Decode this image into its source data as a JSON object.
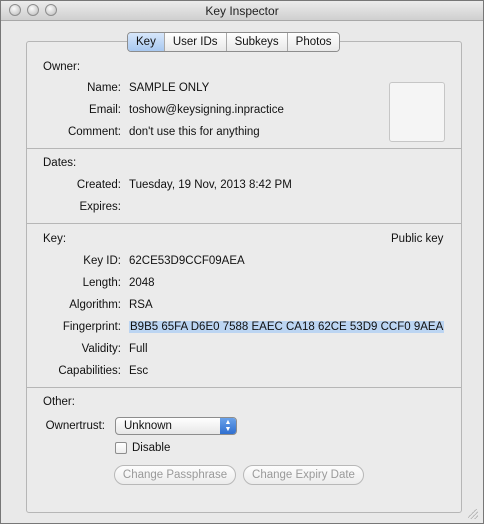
{
  "window": {
    "title": "Key Inspector"
  },
  "tabs": [
    {
      "label": "Key",
      "active": true
    },
    {
      "label": "User IDs"
    },
    {
      "label": "Subkeys"
    },
    {
      "label": "Photos"
    }
  ],
  "owner": {
    "section_label": "Owner:",
    "name_label": "Name:",
    "name_value": "SAMPLE ONLY",
    "email_label": "Email:",
    "email_value": "toshow@keysigning.inpractice",
    "comment_label": "Comment:",
    "comment_value": "don't use this for anything"
  },
  "dates": {
    "section_label": "Dates:",
    "created_label": "Created:",
    "created_value": "Tuesday, 19 Nov, 2013 8:42 PM",
    "expires_label": "Expires:",
    "expires_value": ""
  },
  "key": {
    "section_label": "Key:",
    "type_value": "Public key",
    "key_id_label": "Key ID:",
    "key_id_value": "62CE53D9CCF09AEA",
    "length_label": "Length:",
    "length_value": "2048",
    "algorithm_label": "Algorithm:",
    "algorithm_value": "RSA",
    "fingerprint_label": "Fingerprint:",
    "fingerprint_value": "B9B5 65FA D6E0 7588 EAEC CA18 62CE 53D9 CCF0 9AEA",
    "validity_label": "Validity:",
    "validity_value": "Full",
    "capabilities_label": "Capabilities:",
    "capabilities_value": "Esc"
  },
  "other": {
    "section_label": "Other:",
    "ownertrust_label": "Ownertrust:",
    "ownertrust_value": "Unknown",
    "disable_label": "Disable",
    "change_passphrase_label": "Change Passphrase",
    "change_expiry_label": "Change Expiry Date"
  },
  "icons": {
    "window_controls": [
      "close-icon",
      "minimize-icon",
      "zoom-icon"
    ],
    "select_arrows": "up-down-arrows-icon"
  }
}
